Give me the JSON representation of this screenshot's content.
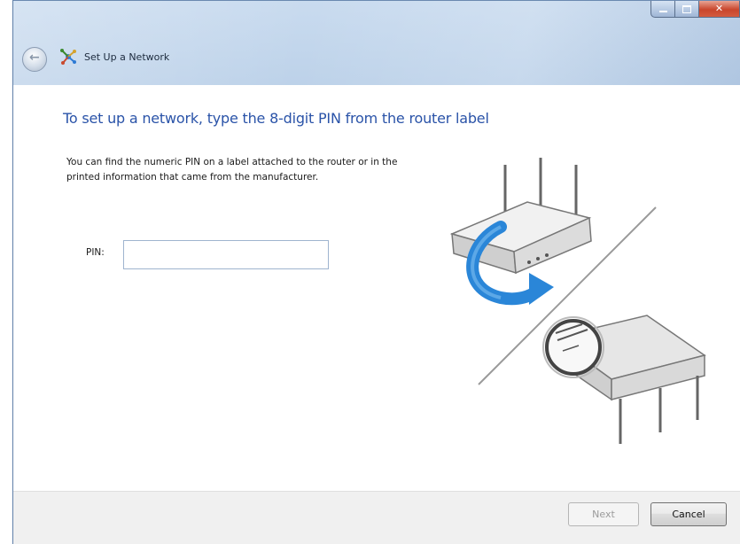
{
  "window": {
    "title": "Set Up a Network",
    "close_glyph": "✕"
  },
  "content": {
    "heading": "To set up a network, type the 8-digit PIN from the router label",
    "description": "You can find the numeric PIN on a label attached to the router or in the printed information that came from the manufacturer.",
    "pin": {
      "label": "PIN:",
      "value": "",
      "placeholder": ""
    }
  },
  "footer": {
    "next_label": "Next",
    "cancel_label": "Cancel"
  },
  "icons": {
    "back": "back-arrow-icon",
    "network": "network-setup-icon",
    "router": "router-illustration",
    "rotate": "rotate-arrow-icon",
    "magnifier": "magnifier-icon"
  },
  "colors": {
    "heading": "#2a53a8",
    "close_button": "#c9462c",
    "arrow": "#2a86d8"
  }
}
